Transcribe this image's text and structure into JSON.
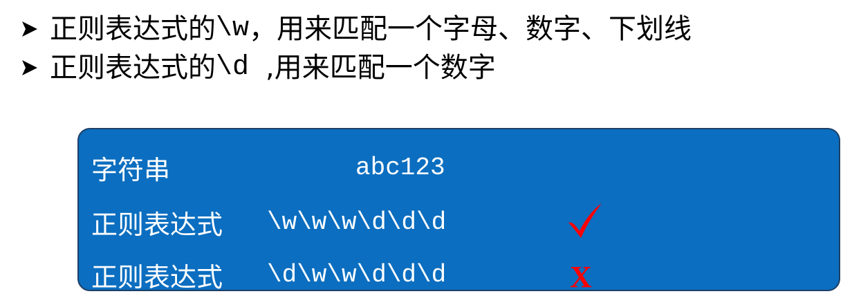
{
  "bullets": [
    {
      "prefix": "正则表达式的",
      "code": "\\w",
      "suffix": "，用来匹配一个字母、数字、下划线"
    },
    {
      "prefix": "正则表达式的",
      "code": "\\d ",
      "suffix": ",用来匹配一个数字"
    }
  ],
  "panel": {
    "rows": [
      {
        "label": "字符串",
        "value": "abc123",
        "mark": ""
      },
      {
        "label": "正则表达式",
        "value": "\\w\\w\\w\\d\\d\\d",
        "mark": "check"
      },
      {
        "label": "正则表达式",
        "value": "\\d\\w\\w\\d\\d\\d",
        "mark": "X"
      }
    ]
  },
  "colors": {
    "panel_bg": "#0B6EC0",
    "panel_text": "#FFFFFF",
    "mark_red": "#FF0000"
  }
}
